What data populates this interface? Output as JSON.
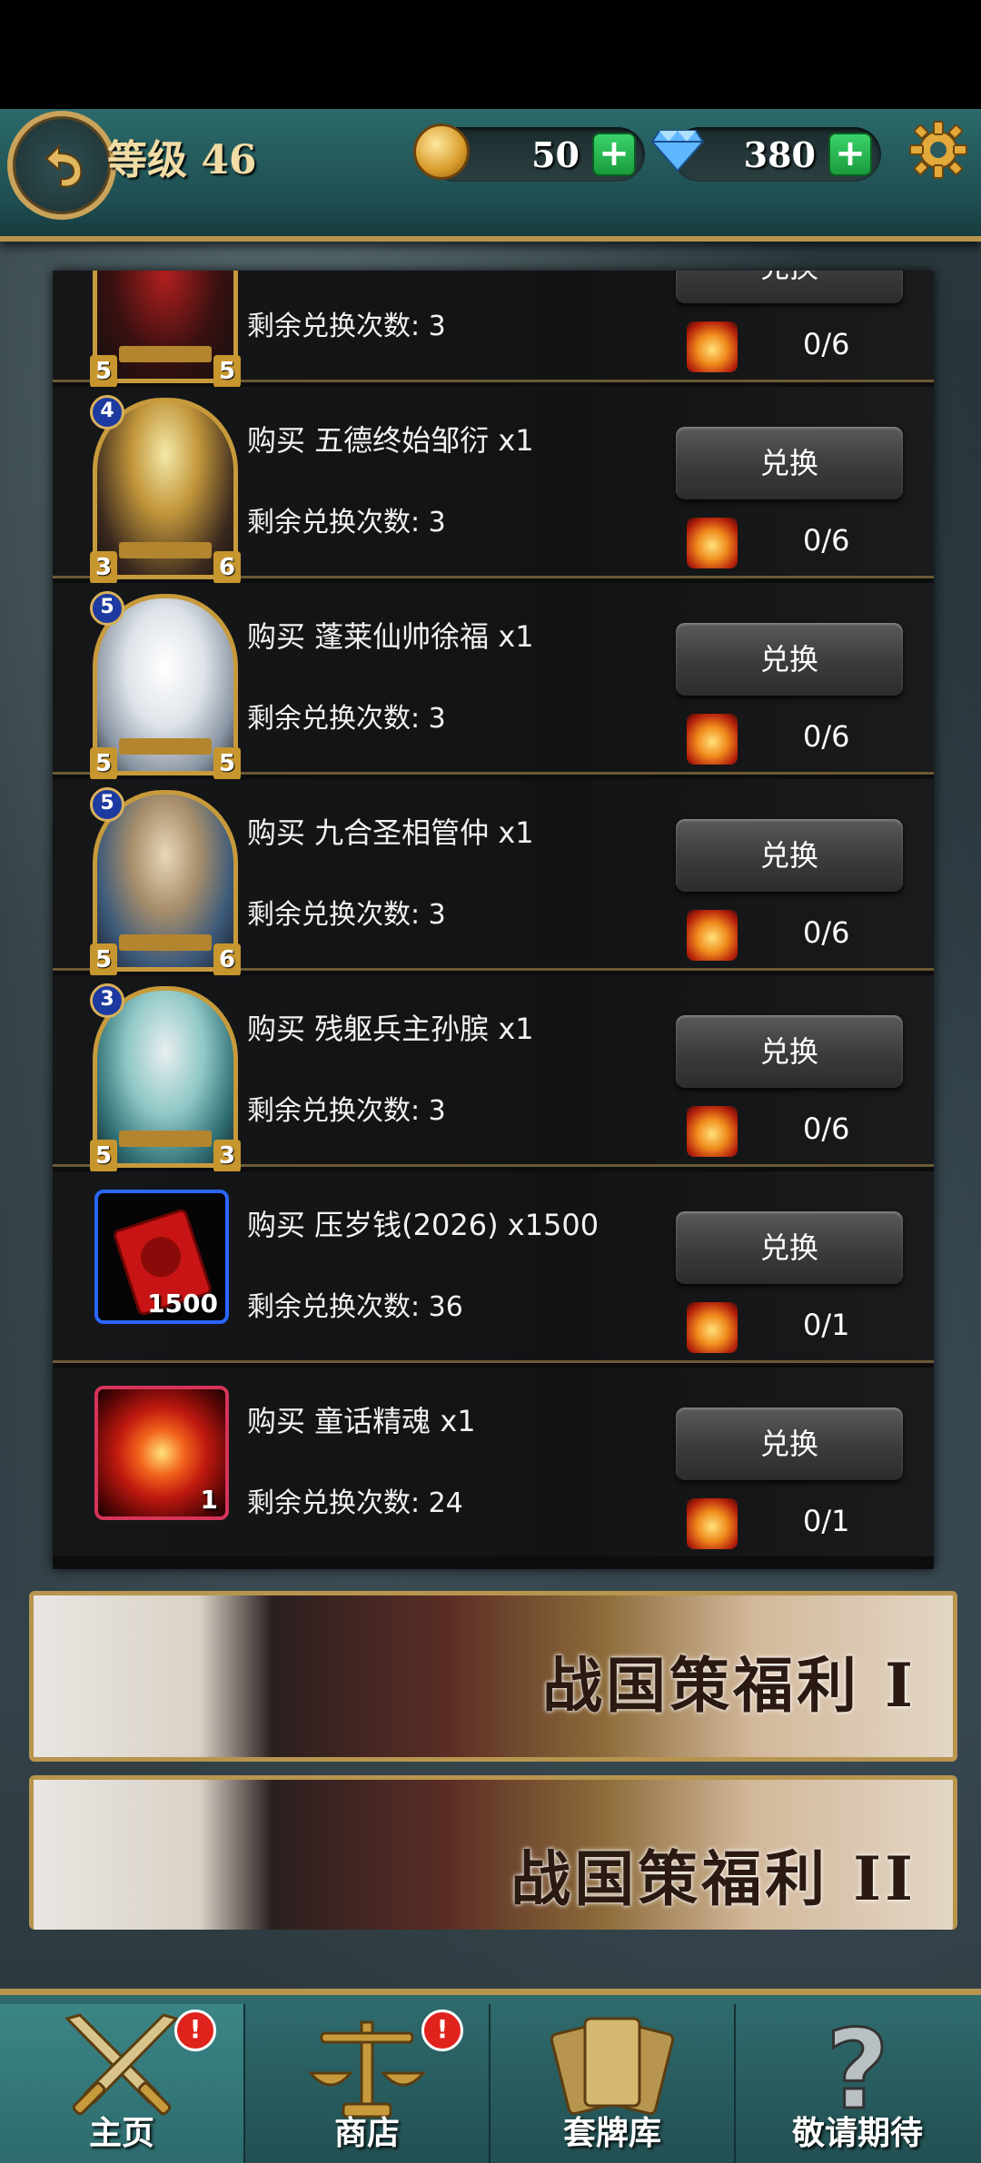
{
  "header": {
    "level_text": "等级 46",
    "coins": "50",
    "gems": "380",
    "plus": "+"
  },
  "exchange_button_label": "兑换",
  "items": [
    {
      "title": "",
      "remain": "剩余兑换次数: 3",
      "cost": "0/6",
      "card_level": "",
      "atk": "5",
      "hp": "5"
    },
    {
      "title": "购买 五德终始邹衍 x1",
      "remain": "剩余兑换次数: 3",
      "cost": "0/6",
      "card_level": "4",
      "atk": "3",
      "hp": "6"
    },
    {
      "title": "购买 蓬莱仙帅徐福 x1",
      "remain": "剩余兑换次数: 3",
      "cost": "0/6",
      "card_level": "5",
      "atk": "5",
      "hp": "5"
    },
    {
      "title": "购买 九合圣相管仲 x1",
      "remain": "剩余兑换次数: 3",
      "cost": "0/6",
      "card_level": "5",
      "atk": "5",
      "hp": "6"
    },
    {
      "title": "购买 残躯兵主孙膑 x1",
      "remain": "剩余兑换次数: 3",
      "cost": "0/6",
      "card_level": "3",
      "atk": "5",
      "hp": "3"
    },
    {
      "title": "购买 压岁钱(2026) x1500",
      "remain": "剩余兑换次数: 36",
      "cost": "0/1",
      "count": "1500"
    },
    {
      "title": "购买 童话精魂 x1",
      "remain": "剩余兑换次数: 24",
      "cost": "0/1",
      "count": "1"
    }
  ],
  "banners": [
    "战国策福利 I",
    "战国策福利 II"
  ],
  "nav": {
    "home": "主页",
    "shop": "商店",
    "decks": "套牌库",
    "coming": "敬请期待",
    "badge": "!"
  },
  "colors": {
    "accent_gold": "#b8954e",
    "teal": "#2b6a6a",
    "badge_red": "#e0221c"
  }
}
